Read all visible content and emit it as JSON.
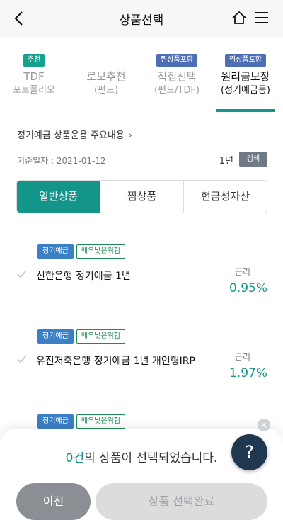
{
  "header": {
    "title": "상품선택",
    "back_icon": "chevron-left-icon",
    "home_icon": "home-icon",
    "menu_icon": "hamburger-menu-icon"
  },
  "category_tabs": [
    {
      "badge": "추천",
      "badge_color": "#17a08d",
      "line1": "TDF",
      "line2": "포트폴리오",
      "active": false
    },
    {
      "badge": "",
      "line1": "로보추천",
      "line2": "(펀드)",
      "active": false
    },
    {
      "badge": "찜상품포함",
      "badge_color": "#4e6fb3",
      "line1": "직접선택",
      "line2": "(펀드/TDF)",
      "active": false
    },
    {
      "badge": "찜상품포함",
      "badge_color": "#4e6fb3",
      "line1": "원리금보장",
      "line2": "(정기예금등)",
      "active": true
    }
  ],
  "notice": {
    "label": "정기예금 상품운용 주요내용",
    "chevron": "›"
  },
  "filter": {
    "base_date": "기준일자 : 2021-01-12",
    "period": "1년",
    "search_label": "검색"
  },
  "segments": [
    {
      "label": "일반상품",
      "active": true
    },
    {
      "label": "찜상품",
      "active": false
    },
    {
      "label": "현금성자산",
      "active": false
    }
  ],
  "products": [
    {
      "type_tag": "정기예금",
      "risk_tag": "매우낮은위험",
      "name": "신한은행 정기예금 1년",
      "rate_label": "금리",
      "rate": "0.95%"
    },
    {
      "type_tag": "정기예금",
      "risk_tag": "매우낮은위험",
      "name": "유진저축은행 정기예금 1년 개인형IRP",
      "rate_label": "금리",
      "rate": "1.97%"
    },
    {
      "type_tag": "정기예금",
      "risk_tag": "매우낮은위험",
      "name": "",
      "rate_label": "",
      "rate": ""
    }
  ],
  "bottom": {
    "selected_count": "0건",
    "selected_suffix": "의 상품이 선택되었습니다.",
    "prev_label": "이전",
    "done_label": "상품 선택완료"
  },
  "help": {
    "label": "?",
    "close": "×"
  },
  "colors": {
    "accent": "#14958a",
    "badge_blue": "#4e6fb3",
    "tag_type": "#3b7fc4",
    "tag_risk": "#1e8a54"
  }
}
